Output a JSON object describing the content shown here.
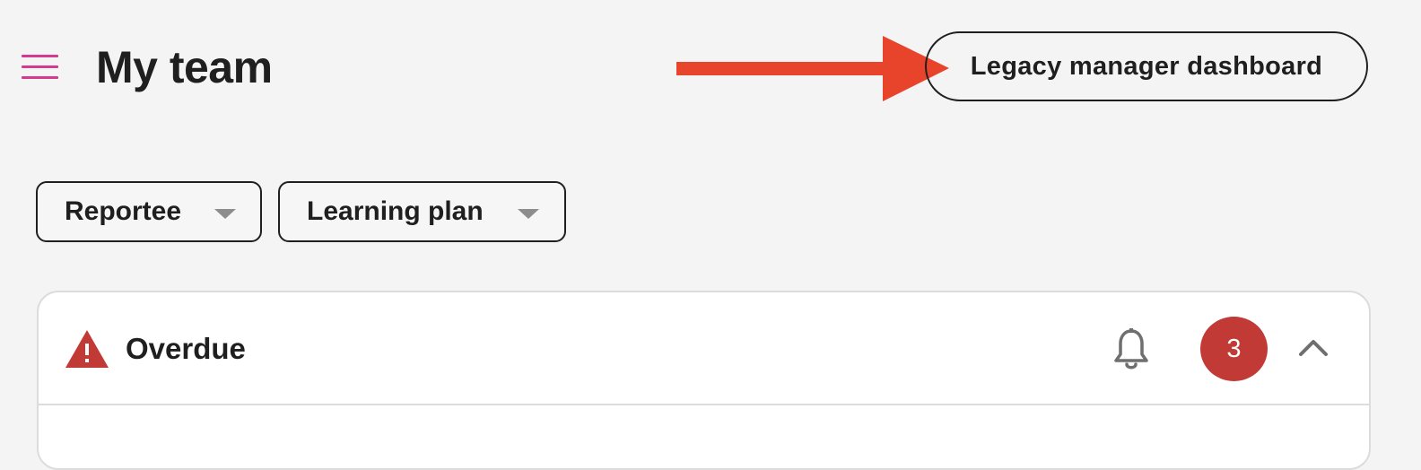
{
  "header": {
    "menu_icon": "hamburger-menu-icon",
    "title": "My team",
    "legacy_button_label": "Legacy manager dashboard"
  },
  "annotation": {
    "icon": "arrow-right-icon",
    "color": "#e8432b"
  },
  "filters": [
    {
      "label": "Reportee",
      "icon": "caret-down-icon"
    },
    {
      "label": "Learning plan",
      "icon": "caret-down-icon"
    }
  ],
  "overdue_section": {
    "icon": "warning-icon",
    "title": "Overdue",
    "notify_icon": "bell-icon",
    "count": "3",
    "collapse_icon": "chevron-up-icon"
  },
  "colors": {
    "accent": "#d63a8e",
    "badge": "#c13a35",
    "warning": "#c13a35",
    "background": "#f4f4f4",
    "text": "#1f1f1f"
  }
}
